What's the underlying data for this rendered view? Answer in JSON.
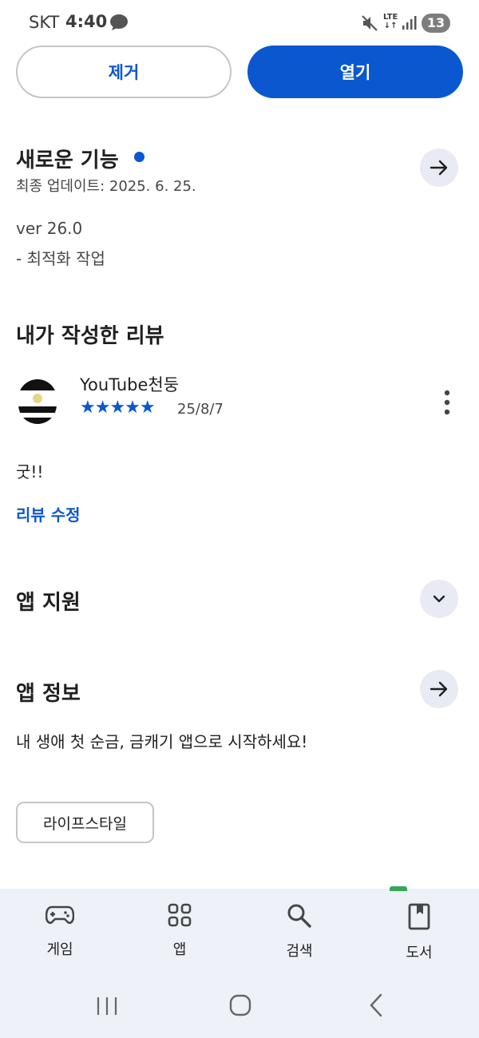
{
  "status_bar": {
    "carrier": "SKT",
    "time": "4:40",
    "network": "LTE",
    "notification_count": "13"
  },
  "actions": {
    "remove_label": "제거",
    "open_label": "열기"
  },
  "whats_new": {
    "title": "새로운 기능",
    "last_updated": "최종 업데이트: 2025. 6. 25.",
    "notes": [
      "ver 26.0",
      "- 최적화 작업"
    ]
  },
  "my_review": {
    "title": "내가 작성한 리뷰",
    "reviewer": "YouTube천둥",
    "rating": 5,
    "stars": "★★★★★",
    "date": "25/8/7",
    "text": "굿!!",
    "edit_label": "리뷰 수정"
  },
  "app_support": {
    "title": "앱 지원"
  },
  "app_info": {
    "title": "앱 정보",
    "description": "내 생애 첫 순금, 금캐기 앱으로 시작하세요!",
    "category_chip": "라이프스타일"
  },
  "bottom_nav": {
    "items": [
      {
        "label": "게임",
        "icon": "gamepad-icon"
      },
      {
        "label": "앱",
        "icon": "apps-grid-icon"
      },
      {
        "label": "검색",
        "icon": "search-icon"
      },
      {
        "label": "도서",
        "icon": "book-icon"
      }
    ]
  },
  "colors": {
    "accent": "#0b57d0",
    "nav_background": "#eef1f8",
    "round_button": "#e8ebf3"
  }
}
